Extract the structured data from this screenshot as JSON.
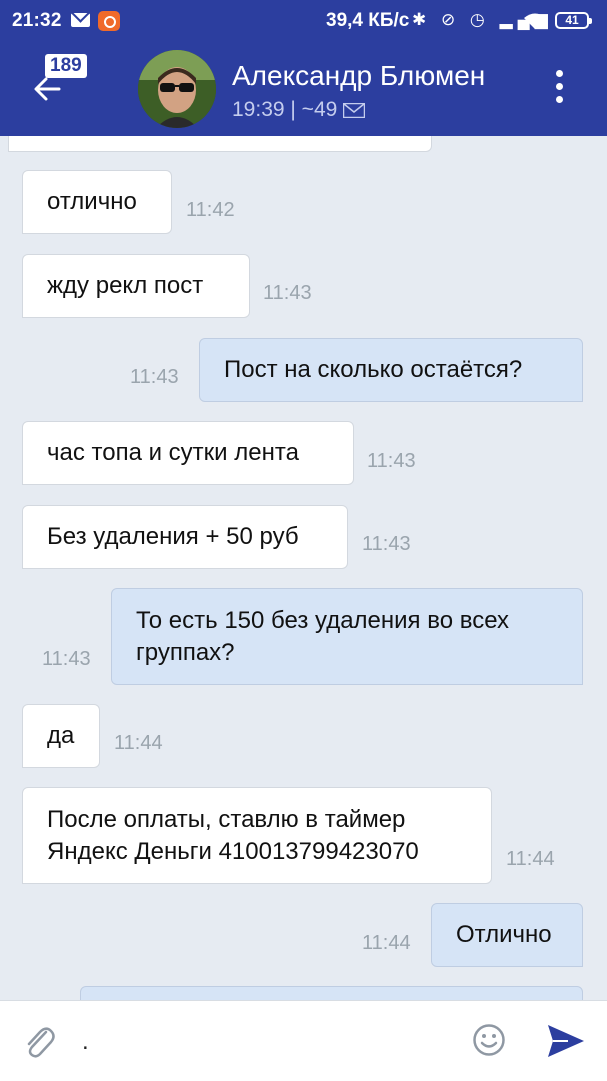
{
  "status_bar": {
    "time": "21:32",
    "speed": "39,4 КБ/с",
    "icons": "✱ ⊘ ◷ ▂▄▆",
    "battery": "41"
  },
  "header": {
    "unread_count": "189",
    "contact_name": "Александр Блюмен",
    "last_seen": "19:39 | ~49",
    "icons": [
      "back-arrow-icon",
      "envelope-icon",
      "more-vertical-icon"
    ]
  },
  "messages": [
    {
      "dir": "in",
      "text": "отлично",
      "time": "11:42"
    },
    {
      "dir": "in",
      "text": "жду рекл пост",
      "time": "11:43"
    },
    {
      "dir": "out",
      "text": "Пост на сколько остаётся?",
      "time": "11:43"
    },
    {
      "dir": "in",
      "text": "час топа и сутки лента",
      "time": "11:43"
    },
    {
      "dir": "in",
      "text": "Без удаления + 50 руб",
      "time": "11:43"
    },
    {
      "dir": "out",
      "text": "То есть 150 без удаления во всех группах?",
      "time": "11:43"
    },
    {
      "dir": "in",
      "text": "да",
      "time": "11:44"
    },
    {
      "dir": "in",
      "text": "После оплаты, ставлю в таймер Яндекс Деньги 410013799423070",
      "time": "11:44"
    },
    {
      "dir": "out",
      "text": "Отлично",
      "time": "11:44"
    }
  ],
  "composer": {
    "value": ".",
    "icons": [
      "paperclip-icon",
      "emoji-icon",
      "send-icon"
    ]
  },
  "colors": {
    "header_bg": "#2c3e9f",
    "chat_bg": "#e6ebf2",
    "incoming_bubble": "#ffffff",
    "outgoing_bubble": "#d6e4f6",
    "send_icon": "#2c3e9f"
  }
}
